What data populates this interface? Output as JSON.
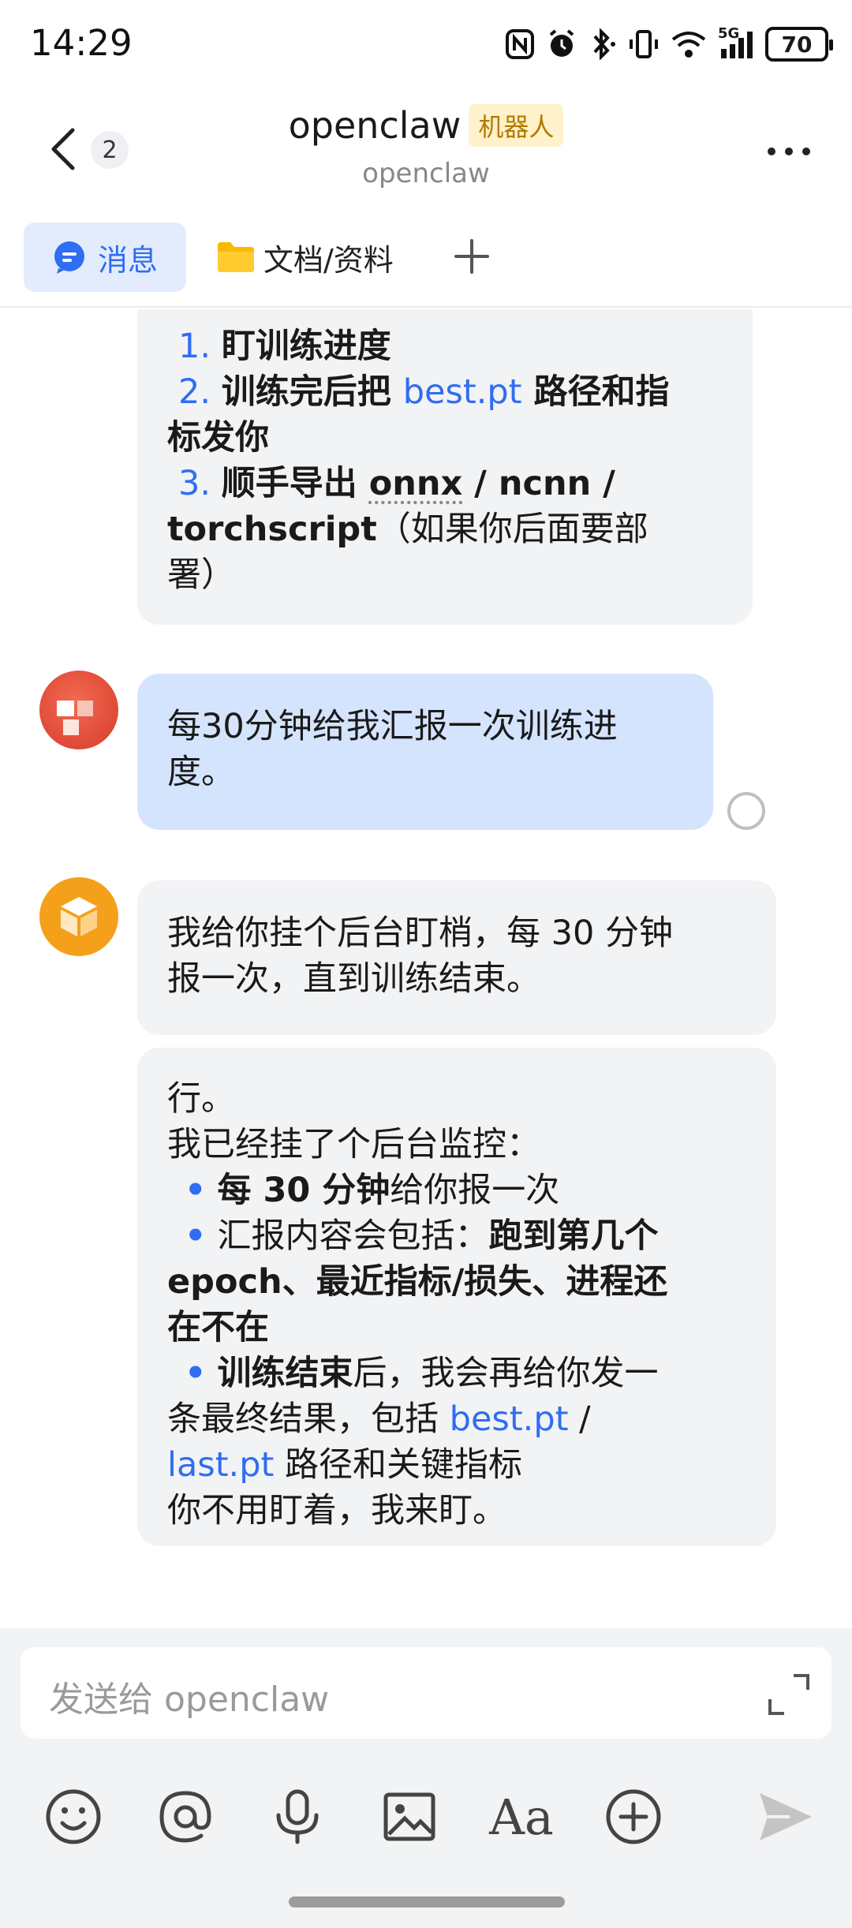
{
  "status_bar": {
    "time": "14:29",
    "network": "5G",
    "battery": "70"
  },
  "header": {
    "unread_count": "2",
    "title": "openclaw",
    "bot_tag": "机器人",
    "subtitle": "openclaw"
  },
  "tabs": {
    "messages": "消息",
    "docs": "文档/资料"
  },
  "messages": {
    "m1": {
      "item1_num": "1.",
      "item1_text": "盯训练进度",
      "item2_num": "2.",
      "item2_pre": "训练完后把 ",
      "item2_link": "best.pt",
      "item2_post": " 路径和指",
      "item2_cont": "标发你",
      "item3_num": "3.",
      "item3_pre": "顺手导出 ",
      "item3_onnx": "onnx",
      "item3_post": " / ncnn /",
      "item3_cont_bold": "torchscript",
      "item3_cont": "（如果你后面要部",
      "item3_end": "署）"
    },
    "m2": {
      "line1": "每30分钟给我汇报一次训练进",
      "line2": "度。"
    },
    "m3": {
      "line1": "我给你挂个后台盯梢，每 30 分钟",
      "line2": "报一次，直到训练结束。"
    },
    "m4": {
      "l1": "行。",
      "l2": "我已经挂了个后台监控：",
      "b1_bold": "每 30 分钟",
      "b1_text": "给你报一次",
      "b2_text": "汇报内容会包括：",
      "b2_bold": "跑到第几个",
      "b2_cont": "epoch、最近指标/损失、进程还",
      "b2_end": "在不在",
      "b3_bold": "训练结束",
      "b3_text": "后，我会再给你发一",
      "b3_cont": "条最终结果，包括 ",
      "b3_link1": "best.pt",
      "b3_sep": " /",
      "b3_link2": "last.pt",
      "b3_cont2": " 路径和关键指标",
      "l_final": "你不用盯着，我来盯。"
    }
  },
  "input": {
    "placeholder": "发送给 openclaw"
  },
  "toolbar": {
    "font_label": "Aa"
  },
  "colors": {
    "accent": "#2f6df2",
    "user_bubble": "#d5e4fd",
    "bot_bubble": "#f2f3f5",
    "bot_avatar": "#f5a01b",
    "tag_bg": "#fff1c9"
  }
}
